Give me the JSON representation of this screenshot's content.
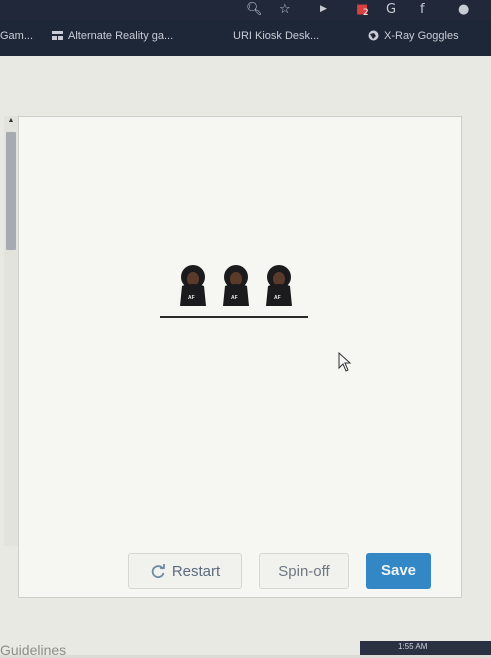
{
  "browser": {
    "bookmarks": [
      {
        "label": "Gam...",
        "icon": "none"
      },
      {
        "label": "Alternate Reality ga...",
        "icon": "grid-icon"
      },
      {
        "label": "URI Kiosk Desk...",
        "icon": "none"
      },
      {
        "label": "X-Ray Goggles",
        "icon": "globe-icon"
      }
    ],
    "extension_badge": "2"
  },
  "editor": {
    "figures": [
      {
        "label": "AF"
      },
      {
        "label": "AF"
      },
      {
        "label": "AF"
      }
    ]
  },
  "buttons": {
    "restart_label": "Restart",
    "spinoff_label": "Spin-off",
    "save_label": "Save"
  },
  "footer": {
    "guidelines_label": "Guidelines",
    "clock": "1:55 AM"
  },
  "colors": {
    "save_button": "#3387c4",
    "restart_text": "#5b6c7e",
    "browser_bar": "#1e2738"
  }
}
